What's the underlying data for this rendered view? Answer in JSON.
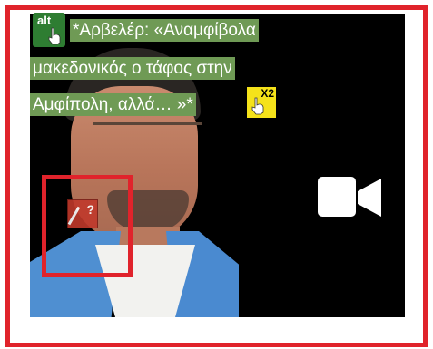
{
  "caption": {
    "line1": "*Αρβελέρ: «Αναμφίβολα",
    "line2": "μακεδονικός ο τάφος στην",
    "line3": "Αμφίπολη, αλλά… »*"
  },
  "alt_badge": {
    "label": "alt",
    "icon": "hand-pointer-icon",
    "color": "#2e7d32"
  },
  "x2_badge": {
    "label": "X2",
    "icon": "hand-pointer-icon",
    "color": "#f5e21a"
  },
  "media": {
    "icon": "video-camera-icon"
  },
  "highlight_icon": {
    "label": "?",
    "icon": "edit-pen-icon"
  },
  "colors": {
    "frame": "#e0232b",
    "caption_bg": "#6f9a55",
    "video_bg": "#000000"
  }
}
